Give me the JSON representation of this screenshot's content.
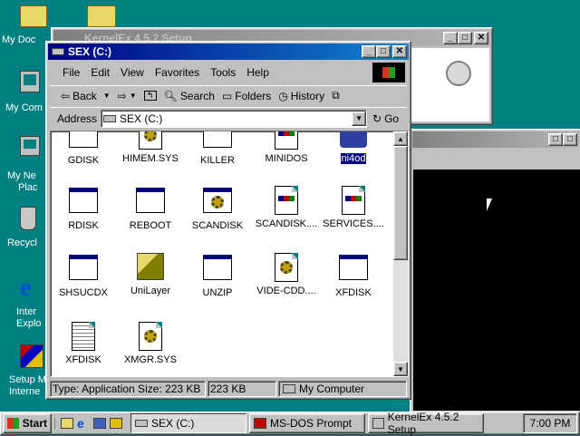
{
  "desktop": {
    "icons": [
      {
        "label": "My Doc",
        "icon": "folder-icon"
      },
      {
        "label": "My Com",
        "icon": "computer-icon"
      },
      {
        "label": "My Ne",
        "icon": "network-icon"
      },
      {
        "label": "Plac",
        "icon": "network-icon"
      },
      {
        "label": "Recycl",
        "icon": "recycle-bin-icon"
      },
      {
        "label": "Inter",
        "icon": "internet-explorer-icon"
      },
      {
        "label": "Explo",
        "icon": "internet-explorer-icon"
      },
      {
        "label": "Setup M",
        "icon": "setup-icon"
      },
      {
        "label": "Interne",
        "icon": "setup-icon"
      }
    ]
  },
  "kernelex_window": {
    "title": "KernelEx 4.5.2 Setup"
  },
  "dos_window": {
    "title": ""
  },
  "explorer": {
    "title": "SEX (C:)",
    "menu": [
      "File",
      "Edit",
      "View",
      "Favorites",
      "Tools",
      "Help"
    ],
    "toolbar": {
      "back": "Back",
      "search": "Search",
      "folders": "Folders",
      "history": "History"
    },
    "address": {
      "label": "Address",
      "value": "SEX (C:)",
      "go": "Go"
    },
    "files": [
      {
        "name": "GDISK",
        "kind": "window"
      },
      {
        "name": "HIMEM.SYS",
        "kind": "config"
      },
      {
        "name": "KILLER",
        "kind": "window"
      },
      {
        "name": "MINIDOS",
        "kind": "document"
      },
      {
        "name": "ni4od",
        "kind": "selected"
      },
      {
        "name": "RDISK",
        "kind": "window"
      },
      {
        "name": "REBOOT",
        "kind": "window"
      },
      {
        "name": "SCANDISK",
        "kind": "window-gear"
      },
      {
        "name": "SCANDISK....",
        "kind": "document"
      },
      {
        "name": "SERVICES....",
        "kind": "document"
      },
      {
        "name": "SHSUCDX",
        "kind": "window"
      },
      {
        "name": "UniLayer",
        "kind": "installer"
      },
      {
        "name": "UNZIP",
        "kind": "window"
      },
      {
        "name": "VIDE-CDD....",
        "kind": "config"
      },
      {
        "name": "XFDISK",
        "kind": "window"
      },
      {
        "name": "XFDISK",
        "kind": "notepad"
      },
      {
        "name": "XMGR.SYS",
        "kind": "config"
      }
    ],
    "status": {
      "type": "Type: Application Size: 223 KB",
      "size": "223 KB",
      "zone": "My Computer"
    }
  },
  "taskbar": {
    "start": "Start",
    "tasks": [
      {
        "label": "SEX (C:)",
        "pressed": true
      },
      {
        "label": "MS-DOS Prompt",
        "pressed": false
      },
      {
        "label": "KernelEx 4.5.2 Setup",
        "pressed": false
      }
    ],
    "clock": "7:00 PM"
  },
  "colors": {
    "desktop": "#008080",
    "titlebar_active": "#000080",
    "face": "#c0c0c0"
  }
}
